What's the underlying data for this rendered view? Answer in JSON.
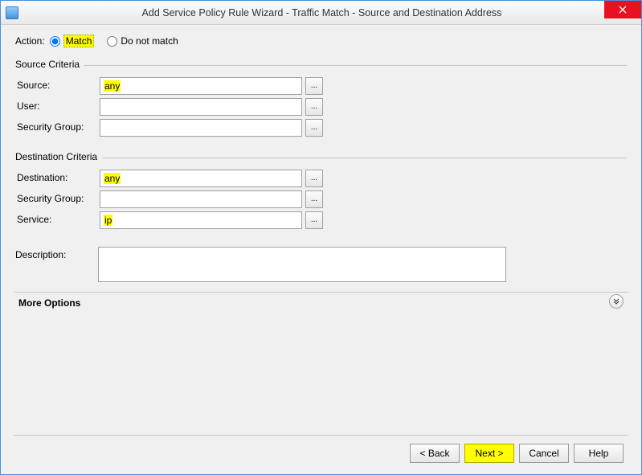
{
  "window": {
    "title": "Add Service Policy Rule Wizard - Traffic Match - Source and Destination Address"
  },
  "action": {
    "label": "Action:",
    "match": "Match",
    "nomatch": "Do not match",
    "selected": "match"
  },
  "source_criteria": {
    "legend": "Source Criteria",
    "source_label": "Source:",
    "source_value": "any",
    "user_label": "User:",
    "user_value": "",
    "secgroup_label": "Security Group:",
    "secgroup_value": ""
  },
  "dest_criteria": {
    "legend": "Destination Criteria",
    "dest_label": "Destination:",
    "dest_value": "any",
    "secgroup_label": "Security Group:",
    "secgroup_value": "",
    "service_label": "Service:",
    "service_value": "ip"
  },
  "description": {
    "label": "Description:",
    "value": ""
  },
  "more_options": {
    "label": "More Options"
  },
  "buttons": {
    "back": "< Back",
    "next": "Next >",
    "cancel": "Cancel",
    "help": "Help"
  },
  "browse": "..."
}
